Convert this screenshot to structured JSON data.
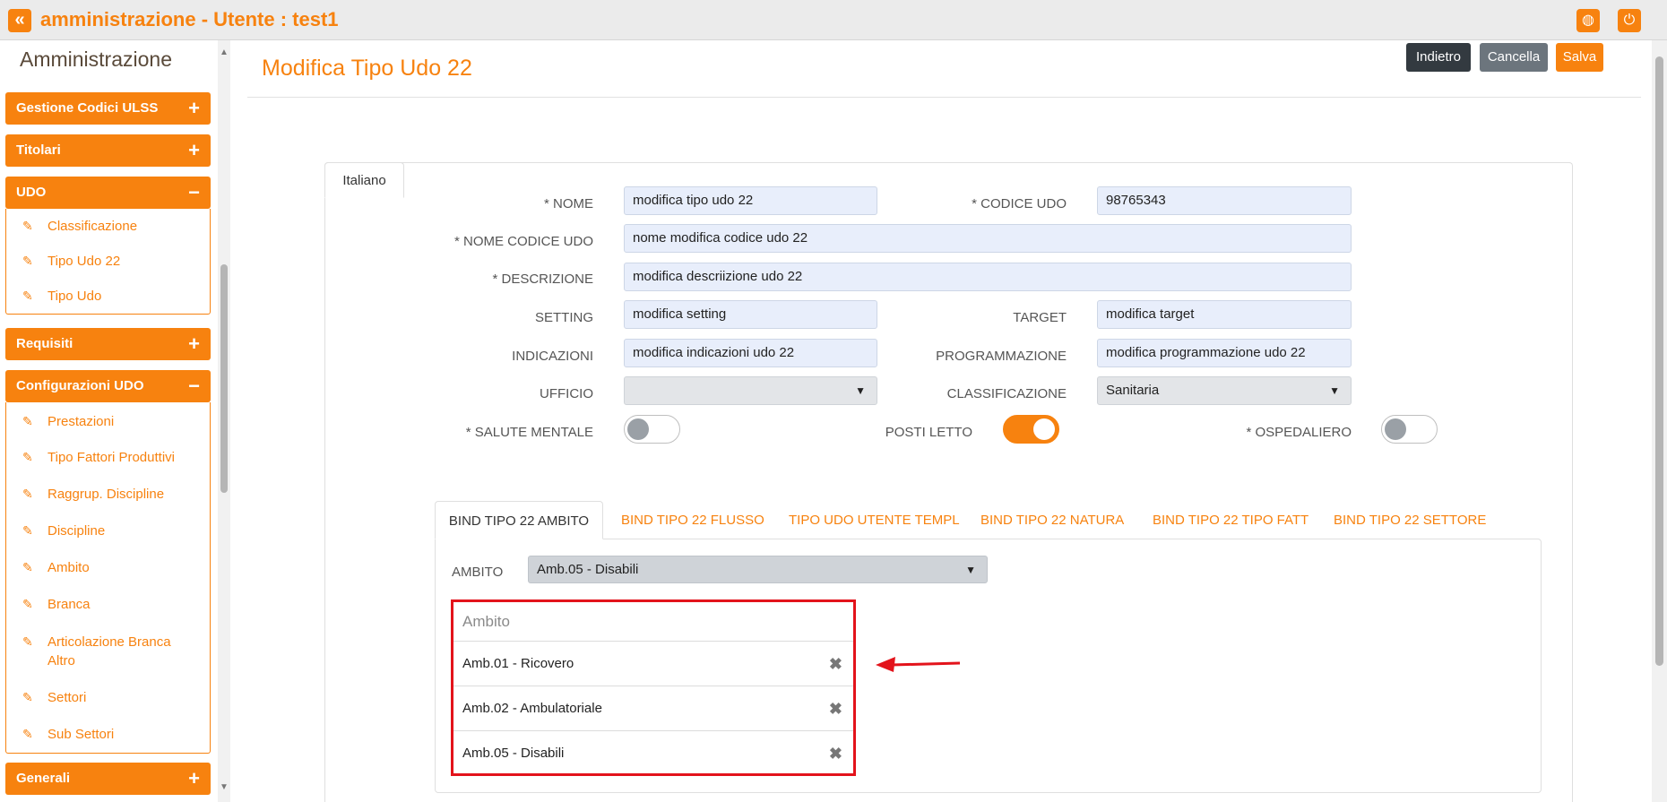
{
  "topbar": {
    "title": "amministrazione - Utente : test1",
    "collapse_glyph": "«",
    "globe_glyph": "◍",
    "power_glyph": "⏻"
  },
  "sidebar": {
    "title": "Amministrazione",
    "groups": [
      {
        "label": "Gestione Codici ULSS",
        "sign": "+",
        "items": []
      },
      {
        "label": "Titolari",
        "sign": "+",
        "items": []
      },
      {
        "label": "UDO",
        "sign": "−",
        "items": [
          "Classificazione",
          "Tipo Udo 22",
          "Tipo Udo"
        ]
      },
      {
        "label": "Requisiti",
        "sign": "+",
        "items": []
      },
      {
        "label": "Configurazioni UDO",
        "sign": "−",
        "items": [
          "Prestazioni",
          "Tipo Fattori Produttivi",
          "Raggrup. Discipline",
          "Discipline",
          "Ambito",
          "Branca",
          "Articolazione Branca Altro",
          "Settori",
          "Sub Settori"
        ]
      },
      {
        "label": "Generali",
        "sign": "+",
        "items": []
      }
    ]
  },
  "page": {
    "title": "Modifica Tipo Udo 22",
    "buttons": {
      "back": "Indietro",
      "cancel": "Cancella",
      "save": "Salva"
    },
    "lang_tab": "Italiano"
  },
  "form": {
    "nome": {
      "label": "* NOME",
      "value": "modifica tipo udo 22"
    },
    "codice_udo": {
      "label": "* CODICE UDO",
      "value": "98765343"
    },
    "nome_codice_udo": {
      "label": "* NOME CODICE UDO",
      "value": "nome modifica codice udo 22"
    },
    "descrizione": {
      "label": "* DESCRIZIONE",
      "value": "modifica descriizione udo 22"
    },
    "setting": {
      "label": "SETTING",
      "value": "modifica setting"
    },
    "target": {
      "label": "TARGET",
      "value": "modifica target"
    },
    "indicazioni": {
      "label": "INDICAZIONI",
      "value": "modifica indicazioni udo 22"
    },
    "programmazione": {
      "label": "PROGRAMMAZIONE",
      "value": "modifica programmazione udo 22"
    },
    "ufficio": {
      "label": "UFFICIO",
      "value": ""
    },
    "classificazione": {
      "label": "CLASSIFICAZIONE",
      "value": "Sanitaria"
    },
    "salute_mentale": {
      "label": "* SALUTE MENTALE",
      "on": false
    },
    "posti_letto": {
      "label": "POSTI LETTO",
      "on": true
    },
    "ospedaliero": {
      "label": "* OSPEDALIERO",
      "on": false
    }
  },
  "subtabs": [
    "BIND TIPO 22 AMBITO",
    "BIND TIPO 22 FLUSSO",
    "TIPO UDO UTENTE TEMPL",
    "BIND TIPO 22 NATURA",
    "BIND TIPO 22 TIPO FATT",
    "BIND TIPO 22 SETTORE"
  ],
  "ambito": {
    "label": "AMBITO",
    "selected": "Amb.05 - Disabili",
    "list_header": "Ambito",
    "rows": [
      "Amb.01 - Ricovero",
      "Amb.02 - Ambulatoriale",
      "Amb.05 - Disabili"
    ]
  },
  "colors": {
    "accent": "#f7820f",
    "highlight": "#e3131b"
  }
}
